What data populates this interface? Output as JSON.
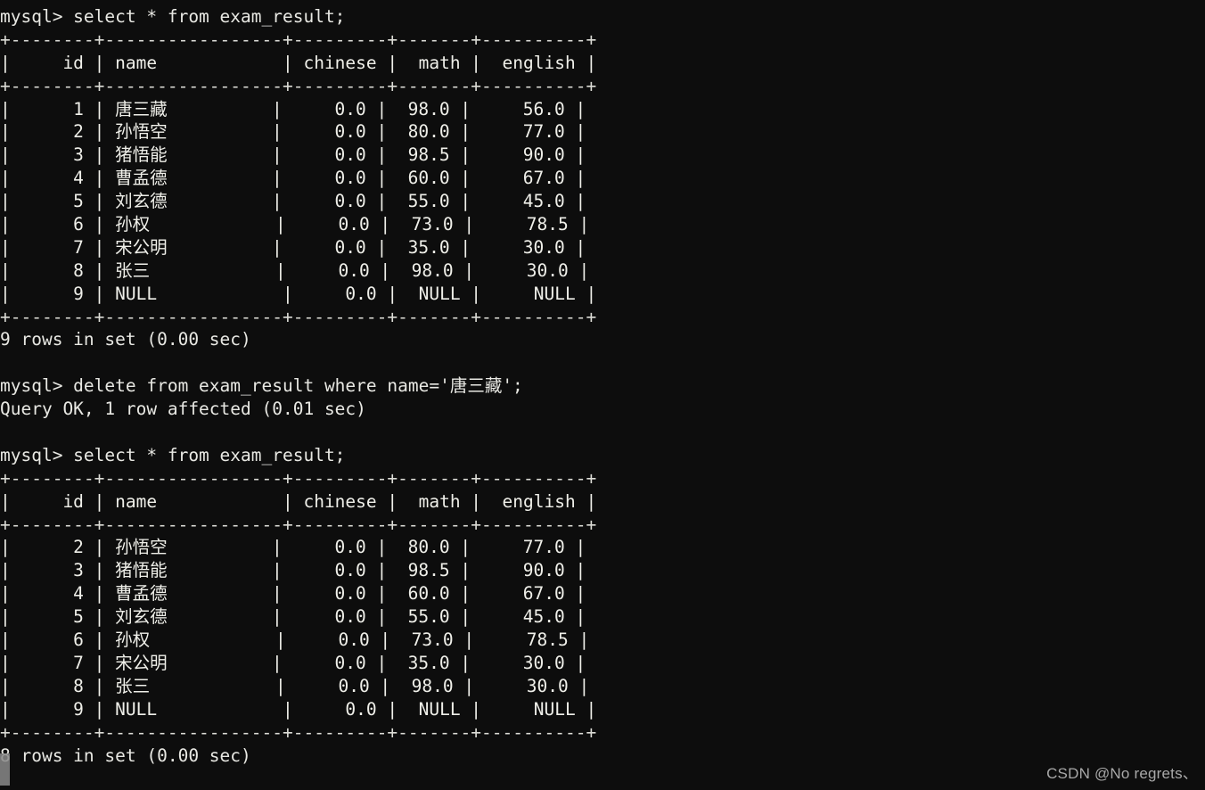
{
  "terminal": {
    "prompt": "mysql> ",
    "background_color": "#0d0d0d",
    "text_color": "#e8e8e3",
    "lines": [
      "mysql> select * from exam_result;",
      "+--------+-----------------+---------+-------+----------+",
      "|     id | name            | chinese |  math |  english |",
      "+--------+-----------------+---------+-------+----------+",
      "|      1 | 唐三藏          |     0.0 |  98.0 |     56.0 |",
      "|      2 | 孙悟空          |     0.0 |  80.0 |     77.0 |",
      "|      3 | 猪悟能          |     0.0 |  98.5 |     90.0 |",
      "|      4 | 曹孟德          |     0.0 |  60.0 |     67.0 |",
      "|      5 | 刘玄德          |     0.0 |  55.0 |     45.0 |",
      "|      6 | 孙权            |     0.0 |  73.0 |     78.5 |",
      "|      7 | 宋公明          |     0.0 |  35.0 |     30.0 |",
      "|      8 | 张三            |     0.0 |  98.0 |     30.0 |",
      "|      9 | NULL            |     0.0 |  NULL |     NULL |",
      "+--------+-----------------+---------+-------+----------+",
      "9 rows in set (0.00 sec)",
      "",
      "mysql> delete from exam_result where name='唐三藏';",
      "Query OK, 1 row affected (0.01 sec)",
      "",
      "mysql> select * from exam_result;",
      "+--------+-----------------+---------+-------+----------+",
      "|     id | name            | chinese |  math |  english |",
      "+--------+-----------------+---------+-------+----------+",
      "|      2 | 孙悟空          |     0.0 |  80.0 |     77.0 |",
      "|      3 | 猪悟能          |     0.0 |  98.5 |     90.0 |",
      "|      4 | 曹孟德          |     0.0 |  60.0 |     67.0 |",
      "|      5 | 刘玄德          |     0.0 |  55.0 |     45.0 |",
      "|      6 | 孙权            |     0.0 |  73.0 |     78.5 |",
      "|      7 | 宋公明          |     0.0 |  35.0 |     30.0 |",
      "|      8 | 张三            |     0.0 |  98.0 |     30.0 |",
      "|      9 | NULL            |     0.0 |  NULL |     NULL |",
      "+--------+-----------------+---------+-------+----------+",
      "8 rows in set (0.00 sec)"
    ],
    "commands": [
      "select * from exam_result;",
      "delete from exam_result where name='唐三藏';",
      "select * from exam_result;"
    ],
    "results": [
      "9 rows in set (0.00 sec)",
      "Query OK, 1 row affected (0.01 sec)",
      "8 rows in set (0.00 sec)"
    ],
    "table_name": "exam_result",
    "columns": [
      "id",
      "name",
      "chinese",
      "math",
      "english"
    ],
    "first_result_set": {
      "row_count_label": "9 rows in set (0.00 sec)",
      "rows": [
        {
          "id": "1",
          "name": "唐三藏",
          "chinese": "0.0",
          "math": "98.0",
          "english": "56.0"
        },
        {
          "id": "2",
          "name": "孙悟空",
          "chinese": "0.0",
          "math": "80.0",
          "english": "77.0"
        },
        {
          "id": "3",
          "name": "猪悟能",
          "chinese": "0.0",
          "math": "98.5",
          "english": "90.0"
        },
        {
          "id": "4",
          "name": "曹孟德",
          "chinese": "0.0",
          "math": "60.0",
          "english": "67.0"
        },
        {
          "id": "5",
          "name": "刘玄德",
          "chinese": "0.0",
          "math": "55.0",
          "english": "45.0"
        },
        {
          "id": "6",
          "name": "孙权",
          "chinese": "0.0",
          "math": "73.0",
          "english": "78.5"
        },
        {
          "id": "7",
          "name": "宋公明",
          "chinese": "0.0",
          "math": "35.0",
          "english": "30.0"
        },
        {
          "id": "8",
          "name": "张三",
          "chinese": "0.0",
          "math": "98.0",
          "english": "30.0"
        },
        {
          "id": "9",
          "name": "NULL",
          "chinese": "0.0",
          "math": "NULL",
          "english": "NULL"
        }
      ]
    },
    "second_result_set": {
      "row_count_label": "8 rows in set (0.00 sec)",
      "rows": [
        {
          "id": "2",
          "name": "孙悟空",
          "chinese": "0.0",
          "math": "80.0",
          "english": "77.0"
        },
        {
          "id": "3",
          "name": "猪悟能",
          "chinese": "0.0",
          "math": "98.5",
          "english": "90.0"
        },
        {
          "id": "4",
          "name": "曹孟德",
          "chinese": "0.0",
          "math": "60.0",
          "english": "67.0"
        },
        {
          "id": "5",
          "name": "刘玄德",
          "chinese": "0.0",
          "math": "55.0",
          "english": "45.0"
        },
        {
          "id": "6",
          "name": "孙权",
          "chinese": "0.0",
          "math": "73.0",
          "english": "78.5"
        },
        {
          "id": "7",
          "name": "宋公明",
          "chinese": "0.0",
          "math": "35.0",
          "english": "30.0"
        },
        {
          "id": "8",
          "name": "张三",
          "chinese": "0.0",
          "math": "98.0",
          "english": "30.0"
        },
        {
          "id": "9",
          "name": "NULL",
          "chinese": "0.0",
          "math": "NULL",
          "english": "NULL"
        }
      ]
    }
  },
  "watermark": {
    "text": "CSDN @No regrets、"
  }
}
